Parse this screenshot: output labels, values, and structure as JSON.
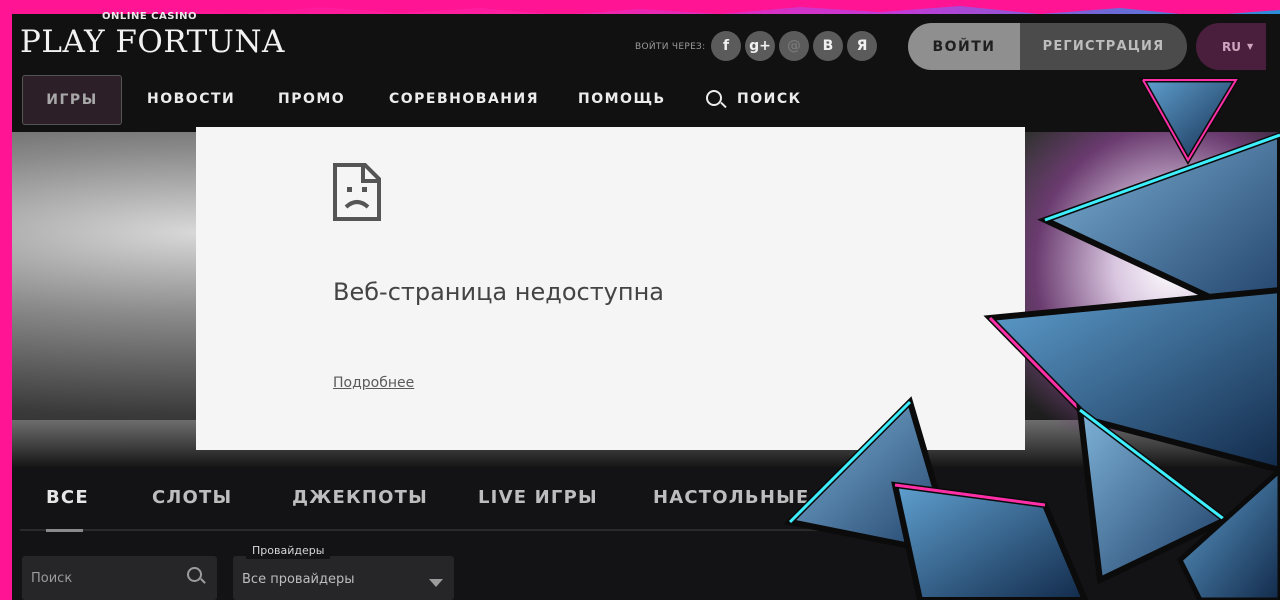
{
  "header": {
    "logo_small": "ONLINE CASINO",
    "logo_big": "PLAY FORTUNA",
    "login_via": "ВОЙТИ ЧЕРЕЗ:",
    "social": [
      {
        "icon": "facebook-icon",
        "glyph": "f"
      },
      {
        "icon": "google-plus-icon",
        "glyph": "g+"
      },
      {
        "icon": "mail-icon",
        "glyph": "@"
      },
      {
        "icon": "vk-icon",
        "glyph": "B"
      },
      {
        "icon": "yandex-icon",
        "glyph": "Я"
      }
    ],
    "login_button": "ВОЙТИ",
    "register_button": "РЕГИСТРАЦИЯ",
    "language": "RU"
  },
  "nav": {
    "items": [
      "ИГРЫ",
      "НОВОСТИ",
      "ПРОМО",
      "СОРЕВНОВАНИЯ",
      "ПОМОЩЬ"
    ],
    "search": "ПОИСК"
  },
  "error": {
    "title": "Веб-страница недоступна",
    "details_link": "Подробнее"
  },
  "games": {
    "tabs": [
      "ВСЕ",
      "СЛОТЫ",
      "ДЖЕКПОТЫ",
      "LIVE ИГРЫ",
      "НАСТОЛЬНЫЕ И"
    ],
    "search_placeholder": "Поиск",
    "provider_label": "Провайдеры",
    "provider_value": "Все провайдеры"
  },
  "colors": {
    "frame_pink": "#ff1493",
    "frame_blue": "#2a8fd8",
    "error_panel": "#f5f5f5"
  }
}
